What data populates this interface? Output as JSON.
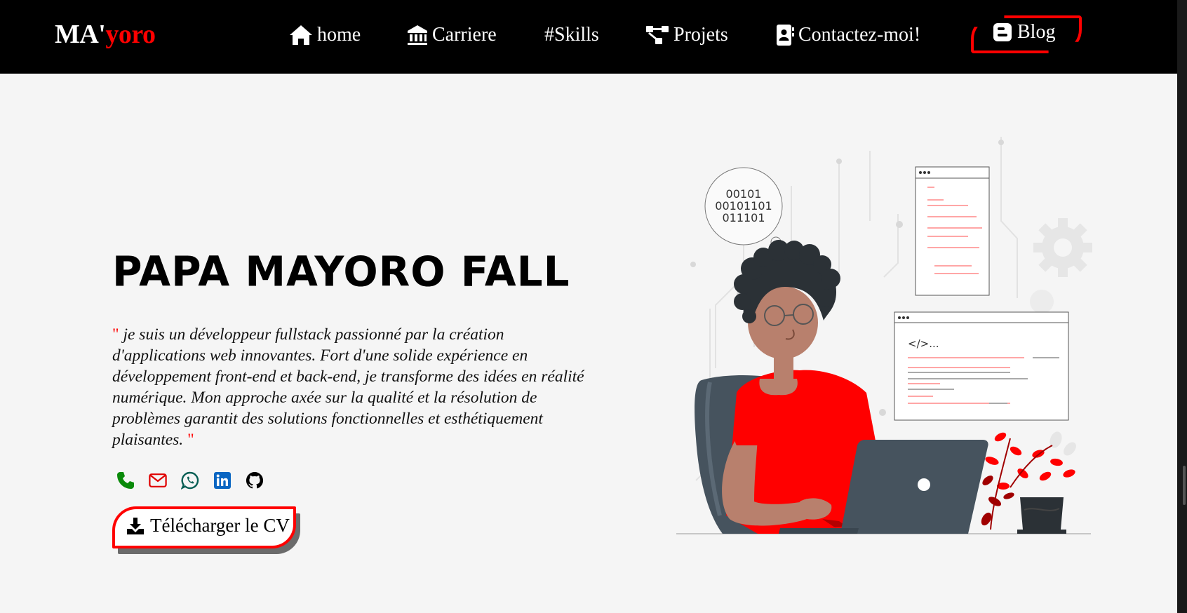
{
  "nav": {
    "brand_main": "MA'",
    "brand_accent": "yoro",
    "items": [
      {
        "label": "home",
        "icon": "home-icon"
      },
      {
        "label": "Carriere",
        "icon": "bank-icon"
      },
      {
        "label": "#Skills",
        "icon": ""
      },
      {
        "label": "Projets",
        "icon": "project-diagram-icon"
      },
      {
        "label": "Contactez-moi!",
        "icon": "address-book-icon"
      },
      {
        "label": "Blog",
        "icon": "blogger-icon"
      }
    ]
  },
  "hero": {
    "name": "PAPA MAYORO FALL",
    "quote_open": "\"",
    "bio": " je suis un développeur fullstack passionné par la création d'applications web innovantes. Fort d'une solide expérience en développement front-end et back-end, je transforme des idées en réalité numérique. Mon approche axée sur la qualité et la résolution de problèmes garantit des solutions fonctionnelles et esthétiquement plaisantes. ",
    "quote_close": "\"",
    "download_label": "Télécharger le CV"
  },
  "socials": [
    {
      "name": "phone-icon",
      "color": "#0a8a0a"
    },
    {
      "name": "email-icon",
      "color": "#e00000"
    },
    {
      "name": "whatsapp-icon",
      "color": "#075e54"
    },
    {
      "name": "linkedin-icon",
      "color": "#0a66c2"
    },
    {
      "name": "github-icon",
      "color": "#000000"
    }
  ],
  "illustration": {
    "binary_lines": [
      "00101",
      "00101101",
      "011101"
    ],
    "code_tag": "</>..."
  },
  "colors": {
    "accent": "#ff0000",
    "navbar": "#000000",
    "background": "#f5f5f5"
  }
}
